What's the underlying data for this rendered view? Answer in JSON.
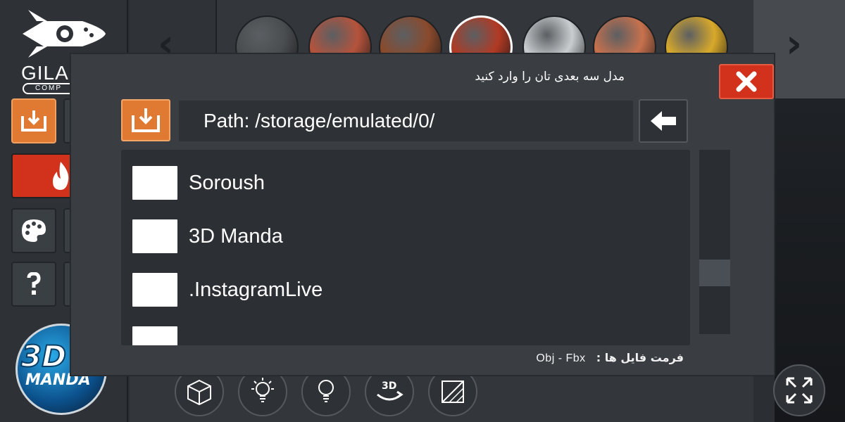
{
  "brand": {
    "company_name": "GILAM",
    "company_sub": "COMP",
    "product_3d": "3D",
    "product_name": "MANDA"
  },
  "material_spheres": [
    {
      "name": "dark-stone",
      "color": "#4a4d50"
    },
    {
      "name": "brick",
      "color": "#b5533c"
    },
    {
      "name": "rusted-metal",
      "color": "#8a4a2c"
    },
    {
      "name": "red-paint",
      "color": "#b13a24"
    },
    {
      "name": "white-plaster",
      "color": "#c9cdd0"
    },
    {
      "name": "copper",
      "color": "#c8714d"
    },
    {
      "name": "gold",
      "color": "#d8a92a"
    }
  ],
  "dialog": {
    "title": "مدل سه بعدی تان را وارد کنید",
    "path_text": "Path: /storage/emulated/0/",
    "files": [
      {
        "name": "Soroush"
      },
      {
        "name": "3D Manda"
      },
      {
        "name": ".InstagramLive"
      },
      {
        "name": ""
      }
    ],
    "format_label": "فرمت فایل ها :",
    "format_value": "Obj - Fbx"
  },
  "colors": {
    "accent_orange": "#e07a33",
    "accent_red": "#d2311c",
    "panel": "#3a3e43",
    "panel_dark": "#2c3034"
  }
}
